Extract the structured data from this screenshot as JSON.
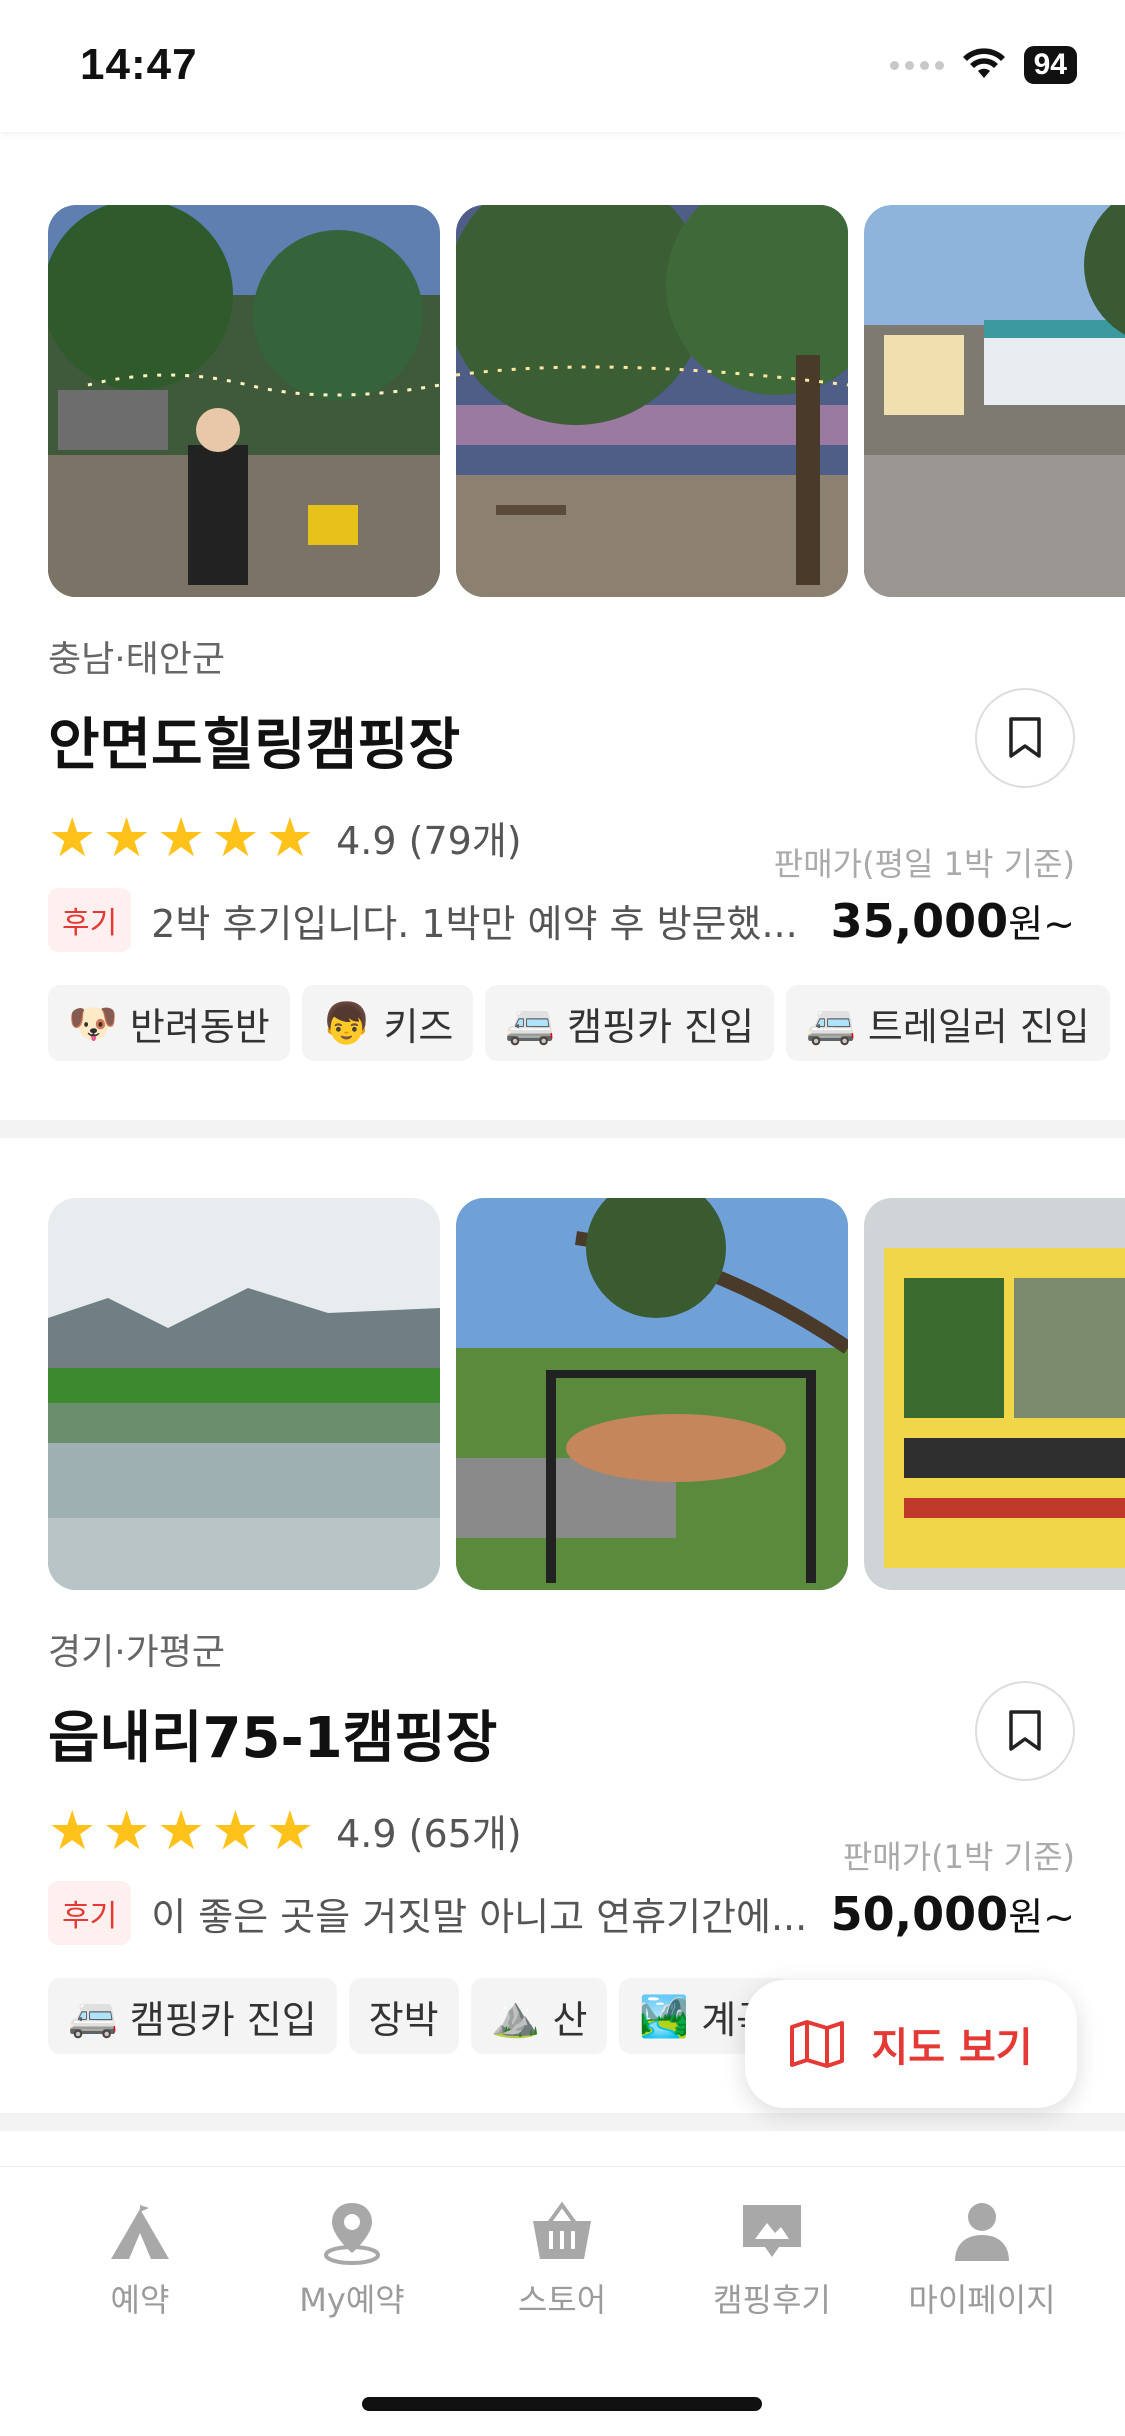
{
  "status_bar": {
    "time": "14:47",
    "battery": "94"
  },
  "listings": [
    {
      "region": "충남·태안군",
      "name": "안면도힐링캠핑장",
      "rating": "4.9",
      "review_count": "(79개)",
      "price_note": "판매가(평일 1박 기준)",
      "review_badge": "후기",
      "review_snippet": "2박 후기입니다. 1박만 예약 후 방문했...",
      "price": "35,000",
      "price_unit": "원~",
      "tags": [
        {
          "icon": "🐶",
          "label": "반려동반"
        },
        {
          "icon": "👦",
          "label": "키즈"
        },
        {
          "icon": "🚐",
          "label": "캠핑카 진입"
        },
        {
          "icon": "🚐",
          "label": "트레일러 진입"
        }
      ]
    },
    {
      "region": "경기·가평군",
      "name": "읍내리75-1캠핑장",
      "rating": "4.9",
      "review_count": "(65개)",
      "price_note": "판매가(1박 기준)",
      "review_badge": "후기",
      "review_snippet": "이 좋은 곳을 거짓말 아니고 연휴기간에...",
      "price": "50,000",
      "price_unit": "원~",
      "tags": [
        {
          "icon": "🚐",
          "label": "캠핑카 진입"
        },
        {
          "icon": "",
          "label": "장박"
        },
        {
          "icon": "⛰️",
          "label": "산"
        },
        {
          "icon": "🏞️",
          "label": "계곡"
        }
      ]
    }
  ],
  "map_button": {
    "label": "지도 보기"
  },
  "tabbar": {
    "items": [
      {
        "label": "예약",
        "icon": "tent-icon"
      },
      {
        "label": "My예약",
        "icon": "location-pin-icon"
      },
      {
        "label": "스토어",
        "icon": "basket-icon"
      },
      {
        "label": "캠핑후기",
        "icon": "review-icon"
      },
      {
        "label": "마이페이지",
        "icon": "person-icon"
      }
    ]
  },
  "colors": {
    "accent": "#E53935",
    "star": "#FFC21A",
    "tab_inactive": "#9B9B9B"
  }
}
